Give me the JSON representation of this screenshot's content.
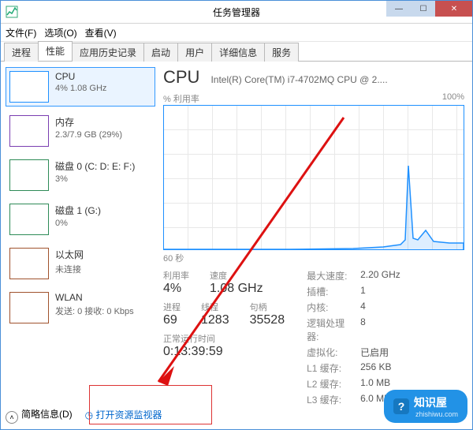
{
  "window": {
    "title": "任务管理器"
  },
  "menu": {
    "file": "文件(F)",
    "options": "选项(O)",
    "view": "查看(V)"
  },
  "tabs": [
    "进程",
    "性能",
    "应用历史记录",
    "启动",
    "用户",
    "详细信息",
    "服务"
  ],
  "sidebar": {
    "items": [
      {
        "title": "CPU",
        "sub": "4% 1.08 GHz"
      },
      {
        "title": "内存",
        "sub": "2.3/7.9 GB (29%)"
      },
      {
        "title": "磁盘 0 (C: D: E: F:)",
        "sub": "3%"
      },
      {
        "title": "磁盘 1 (G:)",
        "sub": "0%"
      },
      {
        "title": "以太网",
        "sub": "未连接"
      },
      {
        "title": "WLAN",
        "sub": "发送: 0 接收: 0 Kbps"
      }
    ]
  },
  "main": {
    "title": "CPU",
    "model": "Intel(R) Core(TM) i7-4702MQ CPU @ 2....",
    "chart": {
      "ylabel": "% 利用率",
      "ymax": "100%",
      "xlabel": "60 秒"
    },
    "stats": {
      "util_l": "利用率",
      "util_v": "4%",
      "speed_l": "速度",
      "speed_v": "1.08 GHz",
      "proc_l": "进程",
      "proc_v": "69",
      "thr_l": "线程",
      "thr_v": "1283",
      "hnd_l": "句柄",
      "hnd_v": "35528",
      "up_l": "正常运行时间",
      "up_v": "0:13:39:59"
    },
    "info": {
      "max_l": "最大速度:",
      "max_v": "2.20 GHz",
      "sock_l": "插槽:",
      "sock_v": "1",
      "core_l": "内核:",
      "core_v": "4",
      "lp_l": "逻辑处理器:",
      "lp_v": "8",
      "virt_l": "虚拟化:",
      "virt_v": "已启用",
      "l1_l": "L1 缓存:",
      "l1_v": "256 KB",
      "l2_l": "L2 缓存:",
      "l2_v": "1.0 MB",
      "l3_l": "L3 缓存:",
      "l3_v": "6.0 MB"
    }
  },
  "footer": {
    "less": "简略信息(D)",
    "resmon": "打开资源监视器"
  },
  "watermark": {
    "brand": "知识屋",
    "url": "zhishiwu.com"
  },
  "chart_data": {
    "type": "line",
    "title": "CPU % 利用率",
    "xlabel": "60 秒",
    "ylabel": "% 利用率",
    "ylim": [
      0,
      100
    ],
    "x_seconds_ago": [
      60,
      55,
      50,
      45,
      40,
      35,
      30,
      25,
      20,
      15,
      12,
      10,
      9,
      8,
      7,
      6,
      5,
      4,
      3,
      2,
      1,
      0
    ],
    "values": [
      0,
      0,
      0,
      0,
      0,
      0,
      0,
      0,
      0,
      1,
      3,
      5,
      12,
      58,
      10,
      8,
      14,
      6,
      5,
      4,
      4,
      4
    ]
  }
}
